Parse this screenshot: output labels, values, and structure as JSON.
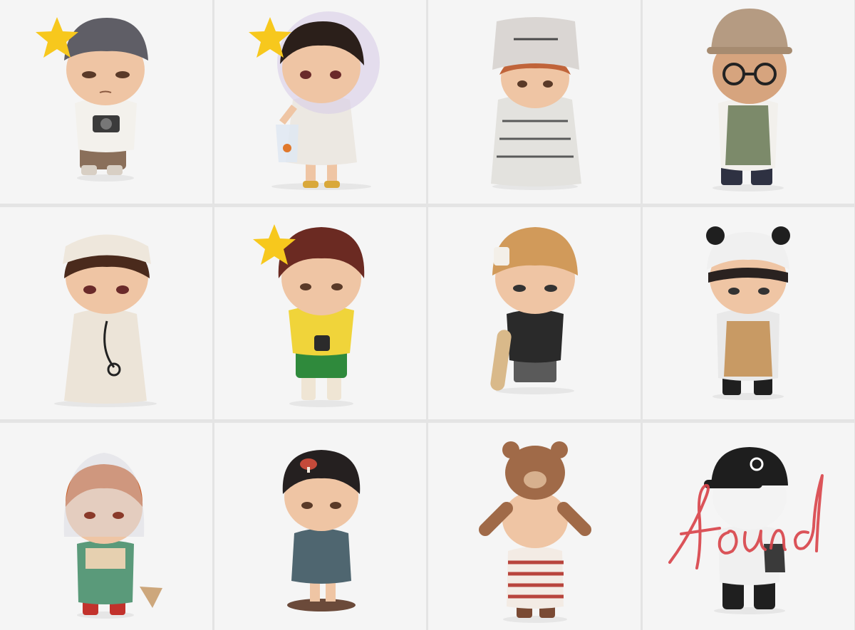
{
  "image": {
    "layout": "grid",
    "rows": 3,
    "columns": 4,
    "tiles": [
      {
        "subject": "figure-beanie-camera",
        "starred": true
      },
      {
        "subject": "figure-bubble-helmet-fishbag",
        "starred": true
      },
      {
        "subject": "figure-newspaper-outfit",
        "starred": false
      },
      {
        "subject": "figure-cap-glasses-apron",
        "starred": false
      },
      {
        "subject": "figure-bandage-doctor",
        "starred": false
      },
      {
        "subject": "figure-yellow-shirt-camera",
        "starred": true
      },
      {
        "subject": "figure-orange-beanie-skateboard",
        "starred": false
      },
      {
        "subject": "figure-panda-hat-apron",
        "starred": false
      },
      {
        "subject": "figure-bag-head-overalls",
        "starred": false
      },
      {
        "subject": "figure-mushroom-hair",
        "starred": false
      },
      {
        "subject": "figure-teddy-bear-on-head",
        "starred": false
      },
      {
        "subject": "figure-black-cap-white",
        "starred": false
      }
    ],
    "handwritten_overlay": {
      "text": "found",
      "color": "#d9464c"
    },
    "star_color": "#f7c81d",
    "tile_background": "#f5f5f5"
  }
}
